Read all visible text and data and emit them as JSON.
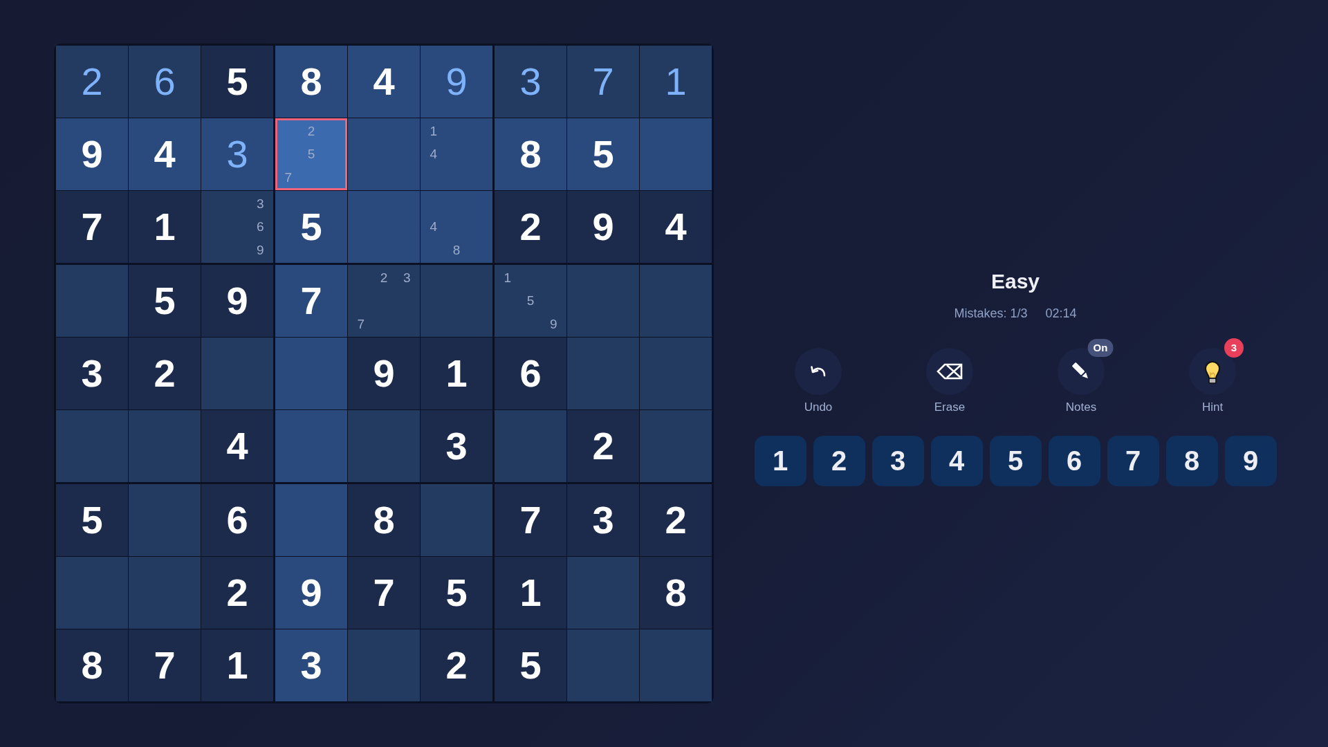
{
  "board": {
    "rows": [
      {
        "cells": [
          {
            "kind": "entry",
            "value": "2",
            "selected": false,
            "highlighted": false
          },
          {
            "kind": "entry",
            "value": "6",
            "selected": false,
            "highlighted": false
          },
          {
            "kind": "given",
            "value": "5",
            "selected": false,
            "highlighted": false
          },
          {
            "kind": "given",
            "value": "8",
            "selected": false,
            "highlighted": true
          },
          {
            "kind": "given",
            "value": "4",
            "selected": false,
            "highlighted": true
          },
          {
            "kind": "entry",
            "value": "9",
            "selected": false,
            "highlighted": true
          },
          {
            "kind": "entry",
            "value": "3",
            "selected": false,
            "highlighted": false
          },
          {
            "kind": "entry",
            "value": "7",
            "selected": false,
            "highlighted": false
          },
          {
            "kind": "entry",
            "value": "1",
            "selected": false,
            "highlighted": false
          }
        ]
      },
      {
        "cells": [
          {
            "kind": "given",
            "value": "9",
            "selected": false,
            "highlighted": true
          },
          {
            "kind": "given",
            "value": "4",
            "selected": false,
            "highlighted": true
          },
          {
            "kind": "entry",
            "value": "3",
            "selected": false,
            "highlighted": true
          },
          {
            "kind": "notes",
            "notes": [
              "2",
              "5",
              "7"
            ],
            "selected": true,
            "highlighted": true
          },
          {
            "kind": "empty",
            "selected": false,
            "highlighted": true
          },
          {
            "kind": "notes",
            "notes": [
              "1",
              "4"
            ],
            "selected": false,
            "highlighted": true
          },
          {
            "kind": "given",
            "value": "8",
            "selected": false,
            "highlighted": true
          },
          {
            "kind": "given",
            "value": "5",
            "selected": false,
            "highlighted": true
          },
          {
            "kind": "empty",
            "selected": false,
            "highlighted": true
          }
        ]
      },
      {
        "cells": [
          {
            "kind": "given",
            "value": "7",
            "selected": false,
            "highlighted": false
          },
          {
            "kind": "given",
            "value": "1",
            "selected": false,
            "highlighted": false
          },
          {
            "kind": "notes",
            "notes": [
              "3",
              "6",
              "9"
            ],
            "selected": false,
            "highlighted": false
          },
          {
            "kind": "given",
            "value": "5",
            "selected": false,
            "highlighted": true
          },
          {
            "kind": "empty",
            "selected": false,
            "highlighted": true
          },
          {
            "kind": "notes",
            "notes": [
              "4",
              "8"
            ],
            "selected": false,
            "highlighted": true
          },
          {
            "kind": "given",
            "value": "2",
            "selected": false,
            "highlighted": false
          },
          {
            "kind": "given",
            "value": "9",
            "selected": false,
            "highlighted": false
          },
          {
            "kind": "given",
            "value": "4",
            "selected": false,
            "highlighted": false
          }
        ]
      },
      {
        "cells": [
          {
            "kind": "empty",
            "selected": false,
            "highlighted": false
          },
          {
            "kind": "given",
            "value": "5",
            "selected": false,
            "highlighted": false
          },
          {
            "kind": "given",
            "value": "9",
            "selected": false,
            "highlighted": false
          },
          {
            "kind": "given",
            "value": "7",
            "selected": false,
            "highlighted": true
          },
          {
            "kind": "notes",
            "notes": [
              "2",
              "3",
              "7"
            ],
            "selected": false,
            "highlighted": false
          },
          {
            "kind": "empty",
            "selected": false,
            "highlighted": false
          },
          {
            "kind": "notes",
            "notes": [
              "1",
              "5",
              "9"
            ],
            "selected": false,
            "highlighted": false
          },
          {
            "kind": "empty",
            "selected": false,
            "highlighted": false
          },
          {
            "kind": "empty",
            "selected": false,
            "highlighted": false
          }
        ]
      },
      {
        "cells": [
          {
            "kind": "given",
            "value": "3",
            "selected": false,
            "highlighted": false
          },
          {
            "kind": "given",
            "value": "2",
            "selected": false,
            "highlighted": false
          },
          {
            "kind": "empty",
            "selected": false,
            "highlighted": false
          },
          {
            "kind": "empty",
            "selected": false,
            "highlighted": true
          },
          {
            "kind": "given",
            "value": "9",
            "selected": false,
            "highlighted": false
          },
          {
            "kind": "given",
            "value": "1",
            "selected": false,
            "highlighted": false
          },
          {
            "kind": "given",
            "value": "6",
            "selected": false,
            "highlighted": false
          },
          {
            "kind": "empty",
            "selected": false,
            "highlighted": false
          },
          {
            "kind": "empty",
            "selected": false,
            "highlighted": false
          }
        ]
      },
      {
        "cells": [
          {
            "kind": "empty",
            "selected": false,
            "highlighted": false
          },
          {
            "kind": "empty",
            "selected": false,
            "highlighted": false
          },
          {
            "kind": "given",
            "value": "4",
            "selected": false,
            "highlighted": false
          },
          {
            "kind": "empty",
            "selected": false,
            "highlighted": true
          },
          {
            "kind": "empty",
            "selected": false,
            "highlighted": false
          },
          {
            "kind": "given",
            "value": "3",
            "selected": false,
            "highlighted": false
          },
          {
            "kind": "empty",
            "selected": false,
            "highlighted": false
          },
          {
            "kind": "given",
            "value": "2",
            "selected": false,
            "highlighted": false
          },
          {
            "kind": "empty",
            "selected": false,
            "highlighted": false
          }
        ]
      },
      {
        "cells": [
          {
            "kind": "given",
            "value": "5",
            "selected": false,
            "highlighted": false
          },
          {
            "kind": "empty",
            "selected": false,
            "highlighted": false
          },
          {
            "kind": "given",
            "value": "6",
            "selected": false,
            "highlighted": false
          },
          {
            "kind": "empty",
            "selected": false,
            "highlighted": true
          },
          {
            "kind": "given",
            "value": "8",
            "selected": false,
            "highlighted": false
          },
          {
            "kind": "empty",
            "selected": false,
            "highlighted": false
          },
          {
            "kind": "given",
            "value": "7",
            "selected": false,
            "highlighted": false
          },
          {
            "kind": "given",
            "value": "3",
            "selected": false,
            "highlighted": false
          },
          {
            "kind": "given",
            "value": "2",
            "selected": false,
            "highlighted": false
          }
        ]
      },
      {
        "cells": [
          {
            "kind": "empty",
            "selected": false,
            "highlighted": false
          },
          {
            "kind": "empty",
            "selected": false,
            "highlighted": false
          },
          {
            "kind": "given",
            "value": "2",
            "selected": false,
            "highlighted": false
          },
          {
            "kind": "given",
            "value": "9",
            "selected": false,
            "highlighted": true
          },
          {
            "kind": "given",
            "value": "7",
            "selected": false,
            "highlighted": false
          },
          {
            "kind": "given",
            "value": "5",
            "selected": false,
            "highlighted": false
          },
          {
            "kind": "given",
            "value": "1",
            "selected": false,
            "highlighted": false
          },
          {
            "kind": "empty",
            "selected": false,
            "highlighted": false
          },
          {
            "kind": "given",
            "value": "8",
            "selected": false,
            "highlighted": false
          }
        ]
      },
      {
        "cells": [
          {
            "kind": "given",
            "value": "8",
            "selected": false,
            "highlighted": false
          },
          {
            "kind": "given",
            "value": "7",
            "selected": false,
            "highlighted": false
          },
          {
            "kind": "given",
            "value": "1",
            "selected": false,
            "highlighted": false
          },
          {
            "kind": "given",
            "value": "3",
            "selected": false,
            "highlighted": true
          },
          {
            "kind": "empty",
            "selected": false,
            "highlighted": false
          },
          {
            "kind": "given",
            "value": "2",
            "selected": false,
            "highlighted": false
          },
          {
            "kind": "given",
            "value": "5",
            "selected": false,
            "highlighted": false
          },
          {
            "kind": "empty",
            "selected": false,
            "highlighted": false
          },
          {
            "kind": "empty",
            "selected": false,
            "highlighted": false
          }
        ]
      }
    ]
  },
  "panel": {
    "difficulty": "Easy",
    "mistakes": "Mistakes: 1/3",
    "timer": "02:14",
    "actions": [
      {
        "kind": "undo",
        "label": "Undo"
      },
      {
        "kind": "erase",
        "label": "Erase"
      },
      {
        "kind": "notes",
        "label": "Notes",
        "badge": {
          "kind": "status",
          "text": "On"
        }
      },
      {
        "kind": "hint",
        "label": "Hint",
        "badge": {
          "kind": "count",
          "text": "3"
        }
      }
    ],
    "number_pad": [
      "1",
      "2",
      "3",
      "4",
      "5",
      "6",
      "7",
      "8",
      "9"
    ]
  }
}
